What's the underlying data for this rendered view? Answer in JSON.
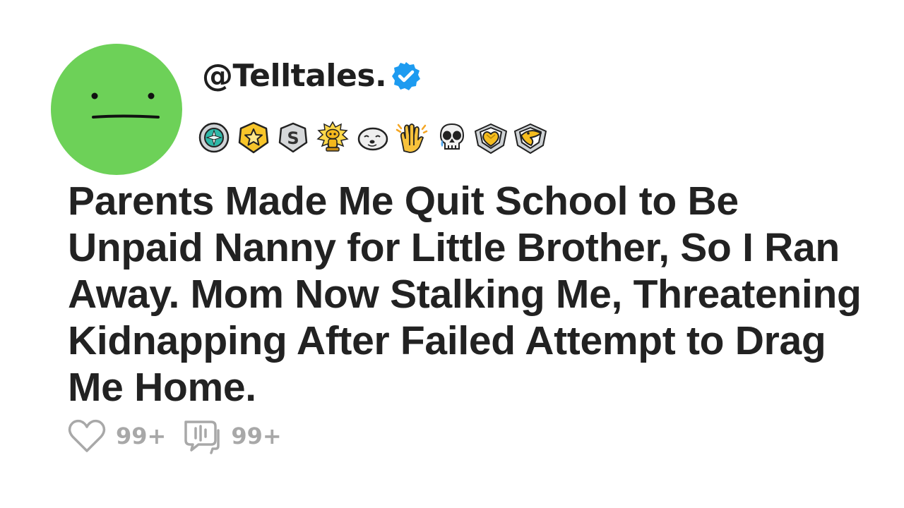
{
  "post": {
    "handle": "@Telltales.",
    "verified_icon": "verified-check-icon",
    "avatar_icon": "neutral-face-icon",
    "avatar_color": "#6dd158",
    "verified_color": "#1d9bf0",
    "title": "Parents Made Me Quit School to Be Unpaid Nanny for Little Brother, So I Ran Away. Mom Now Stalking Me, Threatening Kidnapping After Failed Attempt to Drag Me Home.",
    "badges": [
      "teal-compass-badge-icon",
      "gold-star-badge-icon",
      "silver-s-badge-icon",
      "gold-snoo-trophy-icon",
      "seal-face-icon",
      "clapping-hands-icon",
      "crying-skull-icon",
      "gold-heart-gem-badge-icon",
      "gold-beak-gem-badge-icon"
    ],
    "likes": {
      "icon": "heart-icon",
      "count": "99+"
    },
    "comments": {
      "icon": "comment-bubble-icon",
      "count": "99+"
    }
  }
}
